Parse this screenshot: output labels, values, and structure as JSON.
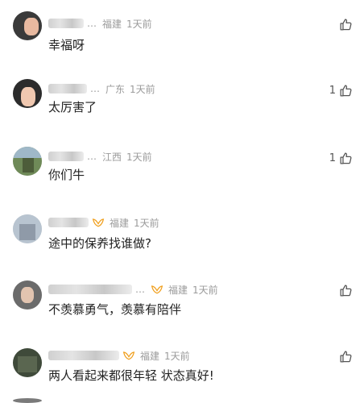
{
  "comments": [
    {
      "nick": "",
      "region": "福建",
      "time": "1天前",
      "text": "幸福呀",
      "likes": ""
    },
    {
      "nick": "",
      "region": "广东",
      "time": "1天前",
      "text": "太厉害了",
      "likes": "1"
    },
    {
      "nick": "",
      "region": "江西",
      "time": "1天前",
      "text": "你们牛",
      "likes": "1"
    },
    {
      "nick": "",
      "region": "福建",
      "time": "1天前",
      "text": "途中的保养找谁做?",
      "likes": ""
    },
    {
      "nick": "",
      "region": "福建",
      "time": "1天前",
      "text": "不羡慕勇气，羡慕有陪伴",
      "likes": ""
    },
    {
      "nick": "",
      "region": "福建",
      "time": "1天前",
      "text": "两人看起来都很年轻 状态真好!",
      "likes": ""
    }
  ],
  "icons": {
    "like": "thumbs-up-icon",
    "vip": "vip-badge-icon"
  },
  "colors": {
    "meta": "#9b9b9b",
    "text": "#222222",
    "vip": "#f0a020"
  }
}
